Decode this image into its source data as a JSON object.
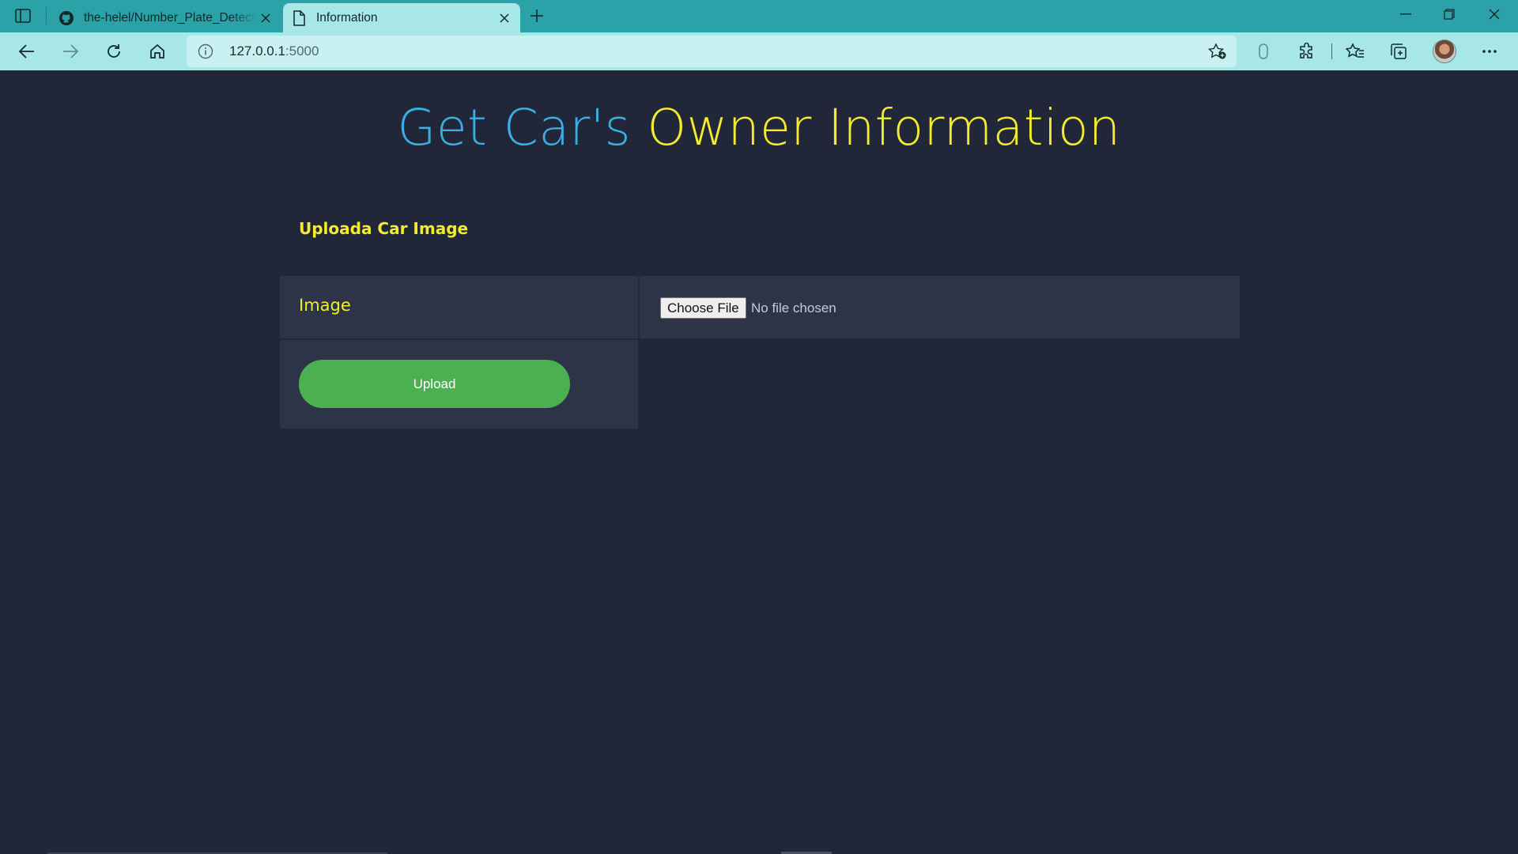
{
  "browser": {
    "tabs": [
      {
        "title": "the-helel/Number_Plate_Detection",
        "icon": "github-icon",
        "active": false
      },
      {
        "title": "Information",
        "icon": "page-icon",
        "active": true
      }
    ],
    "address": {
      "host": "127.0.0.1",
      "port": ":5000"
    }
  },
  "page": {
    "heading_part1": "Get Car's",
    "heading_part2": "Owner Information",
    "subheading": "Uploada Car Image",
    "form": {
      "image_label": "Image",
      "file_button": "Choose File",
      "file_status": "No file chosen",
      "upload_button": "Upload"
    }
  },
  "colors": {
    "tabbar": "#2aa2a8",
    "toolbar": "#a7e7e7",
    "page_bg": "#212739",
    "cell_bg": "#2e3448",
    "heading_blue": "#3aaee0",
    "heading_yellow": "#f2ec2c",
    "upload_green": "#4caf50"
  }
}
